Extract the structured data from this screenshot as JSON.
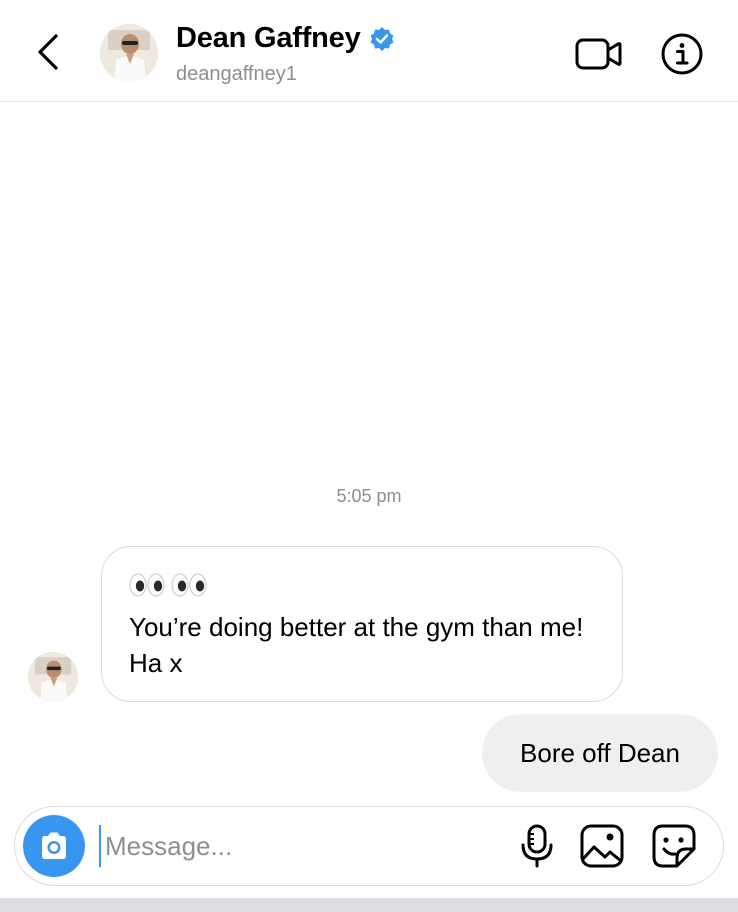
{
  "header": {
    "name": "Dean Gaffney",
    "handle": "deangaffney1",
    "verified": true,
    "icons": {
      "back": "chevron-left-icon",
      "verified": "verified-badge-icon",
      "video": "video-camera-icon",
      "info": "info-icon"
    }
  },
  "conversation": {
    "timestamp": "5:05 pm",
    "messages": [
      {
        "direction": "incoming",
        "emoji": "👀👀",
        "text": "You’re doing better at the gym than me! Ha x"
      },
      {
        "direction": "outgoing",
        "text": "Bore off Dean"
      }
    ]
  },
  "composer": {
    "placeholder": "Message...",
    "value": "",
    "icons": {
      "camera": "camera-icon",
      "mic": "microphone-icon",
      "gallery": "image-icon",
      "sticker": "sticker-icon"
    }
  },
  "colors": {
    "accent": "#3797f0",
    "verified": "#3797f0",
    "incoming_border": "#dbdbdb",
    "outgoing_bubble": "#efefef",
    "secondary_text": "#8e8e8e"
  }
}
